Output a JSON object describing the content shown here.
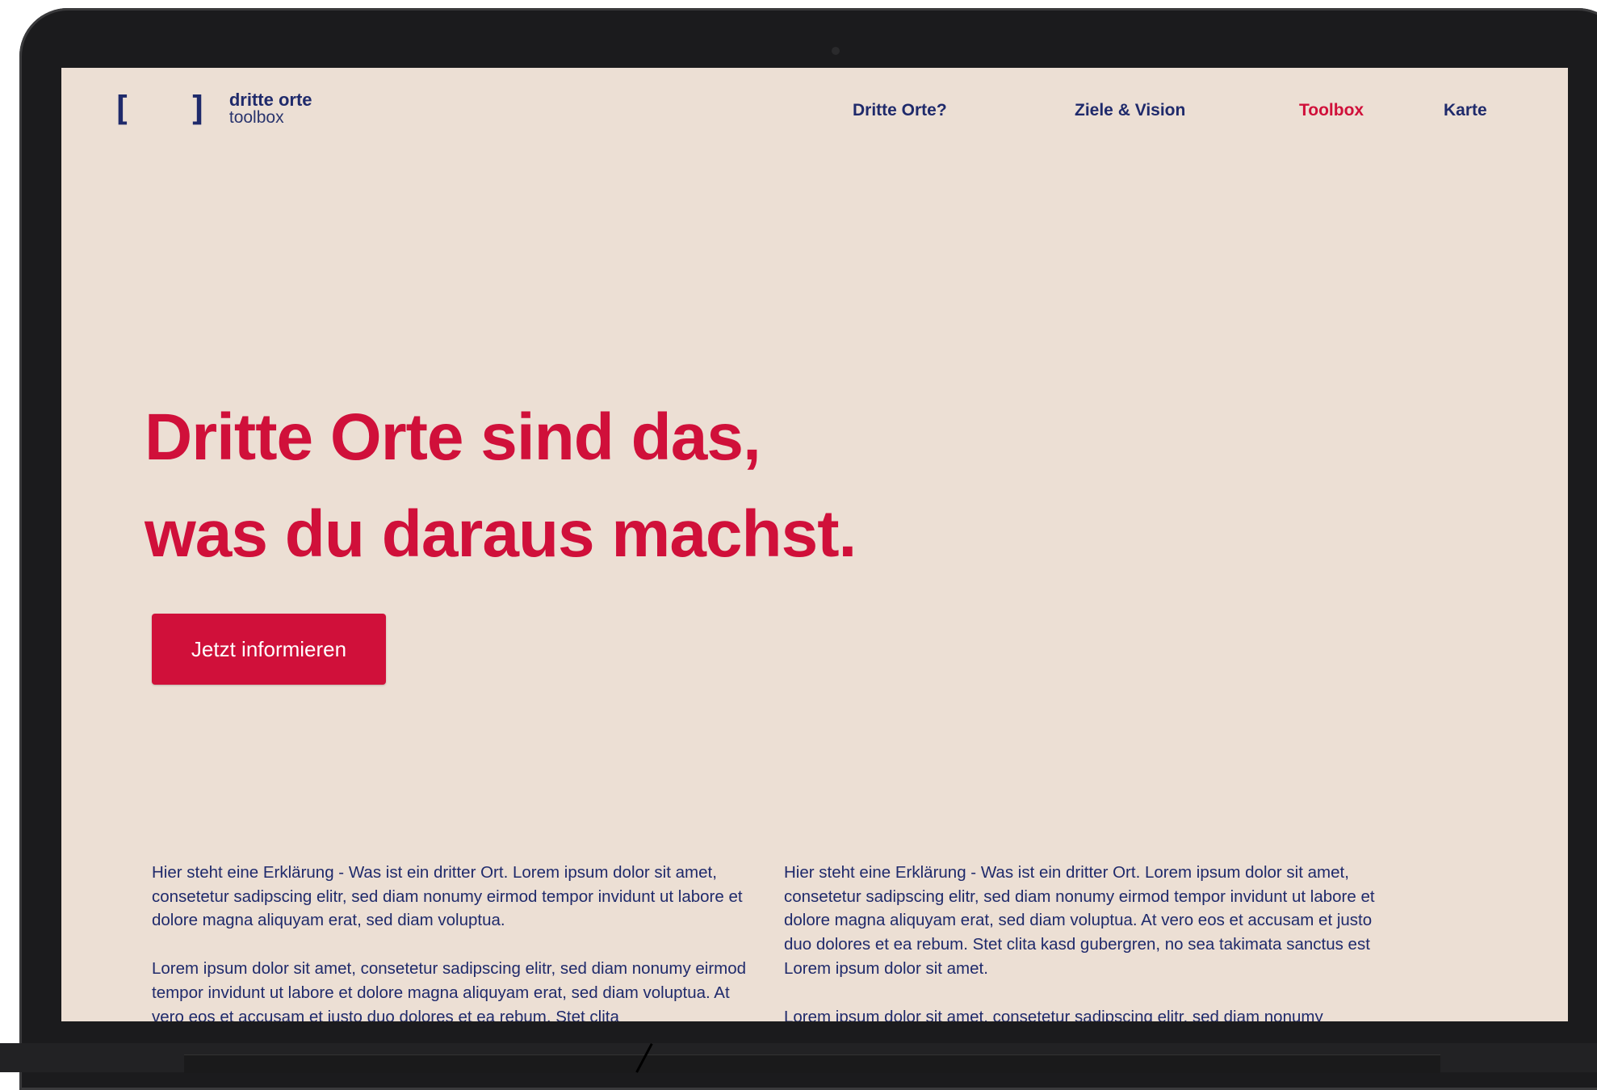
{
  "logo": {
    "brackets": "[ ]",
    "title": "dritte orte",
    "subtitle": "toolbox"
  },
  "nav": [
    {
      "label": "Dritte Orte?",
      "active": false
    },
    {
      "label": "Ziele & Vision",
      "active": false
    },
    {
      "label": "Toolbox",
      "active": true
    },
    {
      "label": "Karte",
      "active": false
    }
  ],
  "hero": {
    "line1": "Dritte Orte sind das,",
    "line2": "was du daraus machst."
  },
  "cta": {
    "label": "Jetzt informieren"
  },
  "columns": {
    "left": {
      "p1": "Hier steht eine Erklärung - Was ist ein dritter Ort. Lorem ipsum dolor sit amet, consetetur sadipscing elitr, sed diam nonumy eirmod tempor invidunt ut labore et dolore magna aliquyam erat, sed diam voluptua.",
      "p2": "Lorem ipsum dolor sit amet, consetetur sadipscing elitr, sed diam nonumy eirmod tempor invidunt ut labore et dolore magna aliquyam erat, sed diam voluptua. At vero eos et accusam et justo duo dolores et ea rebum. Stet clita"
    },
    "right": {
      "p1": "Hier steht eine Erklärung - Was ist ein dritter Ort. Lorem ipsum dolor sit amet, consetetur sadipscing elitr, sed diam nonumy eirmod tempor invidunt ut labore et dolore magna aliquyam erat, sed diam voluptua. At vero eos et accusam et justo duo dolores et ea rebum. Stet clita kasd gubergren, no sea takimata sanctus est Lorem ipsum dolor sit amet.",
      "p2": "Lorem ipsum dolor sit amet, consetetur sadipscing elitr, sed diam nonumy"
    }
  },
  "colors": {
    "background": "#ecdfd4",
    "accent": "#d0103a",
    "navy": "#1f2a6b",
    "device": "#1b1b1d"
  }
}
